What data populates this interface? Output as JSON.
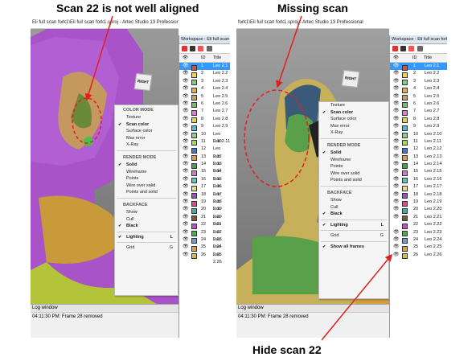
{
  "annotations": {
    "top_left": "Scan 22 is not well aligned",
    "top_right": "Missing scan",
    "bottom": "Hide scan 22"
  },
  "left_window": {
    "title": "Eli full scan fork1\\Eli full scan fork1.sproj - Artec Studio 13 Professional",
    "log_title": "Log window",
    "log_line": "04:11:30 PM: Frame 28 removed",
    "gizmo_label": "RIGHT",
    "context_menu": {
      "sections": [
        {
          "title": "COLOR MODE",
          "items": [
            {
              "label": "Texture",
              "checked": false
            },
            {
              "label": "Scan color",
              "checked": true
            },
            {
              "label": "Surface color",
              "checked": false
            },
            {
              "label": "Max error",
              "checked": false
            },
            {
              "label": "X-Ray",
              "checked": false
            }
          ]
        },
        {
          "title": "RENDER MODE",
          "items": [
            {
              "label": "Solid",
              "checked": true
            },
            {
              "label": "Wireframe",
              "checked": false
            },
            {
              "label": "Points",
              "checked": false
            },
            {
              "label": "Wire over solid",
              "checked": false
            },
            {
              "label": "Points and solid",
              "checked": false
            }
          ]
        },
        {
          "title": "BACKFACE",
          "items": [
            {
              "label": "Show",
              "checked": false
            },
            {
              "label": "Cull",
              "checked": false
            },
            {
              "label": "Black",
              "checked": true
            }
          ]
        }
      ],
      "lighting": {
        "label": "Lighting",
        "shortcut": "L"
      },
      "grid": {
        "label": "Grid",
        "shortcut": "G"
      }
    }
  },
  "right_window": {
    "title": "fork1\\Eli full scan fork1.sproj - Artec Studio 13 Professional",
    "log_title": "Log window",
    "log_line": "04:11:30 PM: Frame 28 removed",
    "gizmo_label": "RIGHT",
    "context_menu": {
      "top_partial": "Texture",
      "sections": [
        {
          "title": "",
          "items": [
            {
              "label": "Scan color",
              "checked": true
            },
            {
              "label": "Surface color",
              "checked": false
            },
            {
              "label": "Max error",
              "checked": false
            },
            {
              "label": "X-Ray",
              "checked": false
            }
          ]
        },
        {
          "title": "RENDER MODE",
          "items": [
            {
              "label": "Solid",
              "checked": true
            },
            {
              "label": "Wireframe",
              "checked": false
            },
            {
              "label": "Points",
              "checked": false
            },
            {
              "label": "Wire over solid",
              "checked": false
            },
            {
              "label": "Points and solid",
              "checked": false
            }
          ]
        },
        {
          "title": "BACKFACE",
          "items": [
            {
              "label": "Show",
              "checked": false
            },
            {
              "label": "Cull",
              "checked": false
            },
            {
              "label": "Black",
              "checked": true
            }
          ]
        }
      ],
      "lighting": {
        "label": "Lighting",
        "shortcut": "L"
      },
      "grid": {
        "label": "Grid",
        "shortcut": "G"
      },
      "show_all": "Show all frames"
    }
  },
  "workspace_left": {
    "title": "Workspace - Eli full scan fork1",
    "col_id": "ID",
    "col_title": "Title"
  },
  "workspace_right": {
    "title": "Workspace - Eli full scan fork1",
    "col_id": "ID",
    "col_title": "Title"
  },
  "scans": [
    {
      "id": "1",
      "title": "Leo 2.1",
      "color": "#d94a4a"
    },
    {
      "id": "2",
      "title": "Leo 2.2",
      "color": "#e8d84a"
    },
    {
      "id": "3",
      "title": "Leo 2.3",
      "color": "#7fd17f"
    },
    {
      "id": "4",
      "title": "Leo 2.4",
      "color": "#e8b04a"
    },
    {
      "id": "5",
      "title": "Leo 2.5",
      "color": "#c9a06a"
    },
    {
      "id": "6",
      "title": "Leo 2.6",
      "color": "#6fbf6f"
    },
    {
      "id": "7",
      "title": "Leo 2.7",
      "color": "#e07ad9"
    },
    {
      "id": "8",
      "title": "Leo 2.8",
      "color": "#d9d94a"
    },
    {
      "id": "9",
      "title": "Leo 2.9",
      "color": "#4ac0e0"
    },
    {
      "id": "10",
      "title": "Leo 2.10",
      "color": "#8fd08f"
    },
    {
      "id": "11",
      "title": "Leo 2.11",
      "color": "#a0e04a"
    },
    {
      "id": "12",
      "title": "Leo 2.12",
      "color": "#3a7ad9"
    },
    {
      "id": "13",
      "title": "Leo 2.13",
      "color": "#e09a4a"
    },
    {
      "id": "14",
      "title": "Leo 2.14",
      "color": "#4aa04a"
    },
    {
      "id": "15",
      "title": "Leo 2.15",
      "color": "#d07ad0"
    },
    {
      "id": "16",
      "title": "Leo 2.16",
      "color": "#4ad0c0"
    },
    {
      "id": "17",
      "title": "Leo 2.17",
      "color": "#e0e08a"
    },
    {
      "id": "18",
      "title": "Leo 2.18",
      "color": "#a04ad0"
    },
    {
      "id": "19",
      "title": "Leo 2.19",
      "color": "#e04a8a"
    },
    {
      "id": "20",
      "title": "Leo 2.20",
      "color": "#3ab0a0"
    },
    {
      "id": "21",
      "title": "Leo 2.21",
      "color": "#7a5a3a"
    },
    {
      "id": "22",
      "title": "Leo 2.22",
      "color": "#c84ad0"
    },
    {
      "id": "23",
      "title": "Leo 2.23",
      "color": "#4ab04a"
    },
    {
      "id": "24",
      "title": "Leo 2.24",
      "color": "#6a9ae0"
    },
    {
      "id": "25",
      "title": "Leo 2.25",
      "color": "#e0a04a"
    },
    {
      "id": "26",
      "title": "Leo 2.26",
      "color": "#d0c04a"
    }
  ],
  "colors": {
    "selection": "#3399ff",
    "annotation_red": "#e02020",
    "viewport_bg": "#8a8a8a"
  }
}
